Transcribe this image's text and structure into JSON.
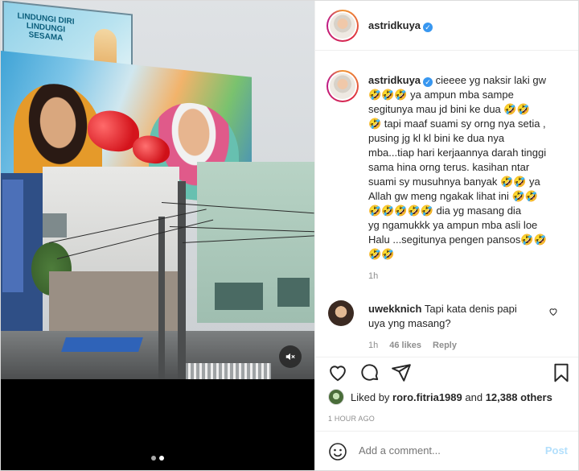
{
  "post": {
    "author": "astridkuya",
    "caption_author": "astridkuya",
    "caption_lines": [
      "cieeee yg naksir laki gw",
      "🤣🤣🤣 ya ampun mba sampe",
      "segitunya mau jd bini ke dua 🤣🤣",
      "🤣 tapi maaf suami sy orng nya setia ,",
      "pusing jg kl kl bini ke dua nya",
      "mba...tiap hari kerjaannya darah tinggi",
      "sama hina orng terus. kasihan ntar",
      "suami sy musuhnya banyak 🤣🤣 ya",
      "Allah gw meng ngakak lihat ini 🤣🤣",
      "🤣🤣🤣🤣🤣 dia yg masang dia",
      "yg ngamukkk ya ampun mba asli loe",
      "Halu ...segitunya pengen pansos🤣🤣",
      "🤣🤣"
    ],
    "caption_time": "1h",
    "likes_text_prefix": "Liked by ",
    "liked_by": "roro.fitria1989",
    "likes_and": " and ",
    "likes_others": "12,388 others",
    "posted_ago": "1 HOUR AGO"
  },
  "comments": [
    {
      "user": "uwekknich",
      "text_line1": "Tapi kata denis papi",
      "text_line2": "uya yng masang?",
      "time": "1h",
      "likes": "46 likes",
      "reply": "Reply"
    }
  ],
  "media": {
    "billboard_small_text": "LINDUNGI DIRI LINDUNGI SESAMA",
    "slide_count": 2,
    "active_slide": 2
  },
  "composer": {
    "placeholder": "Add a comment...",
    "post_label": "Post"
  },
  "colors": {
    "verified": "#3897f0",
    "post_button": "#b2dffc",
    "muted_text": "#8e8e8e"
  },
  "icons": [
    "verified-badge-icon",
    "mute-icon",
    "heart-icon",
    "comment-icon",
    "share-icon",
    "bookmark-icon",
    "emoji-icon"
  ]
}
